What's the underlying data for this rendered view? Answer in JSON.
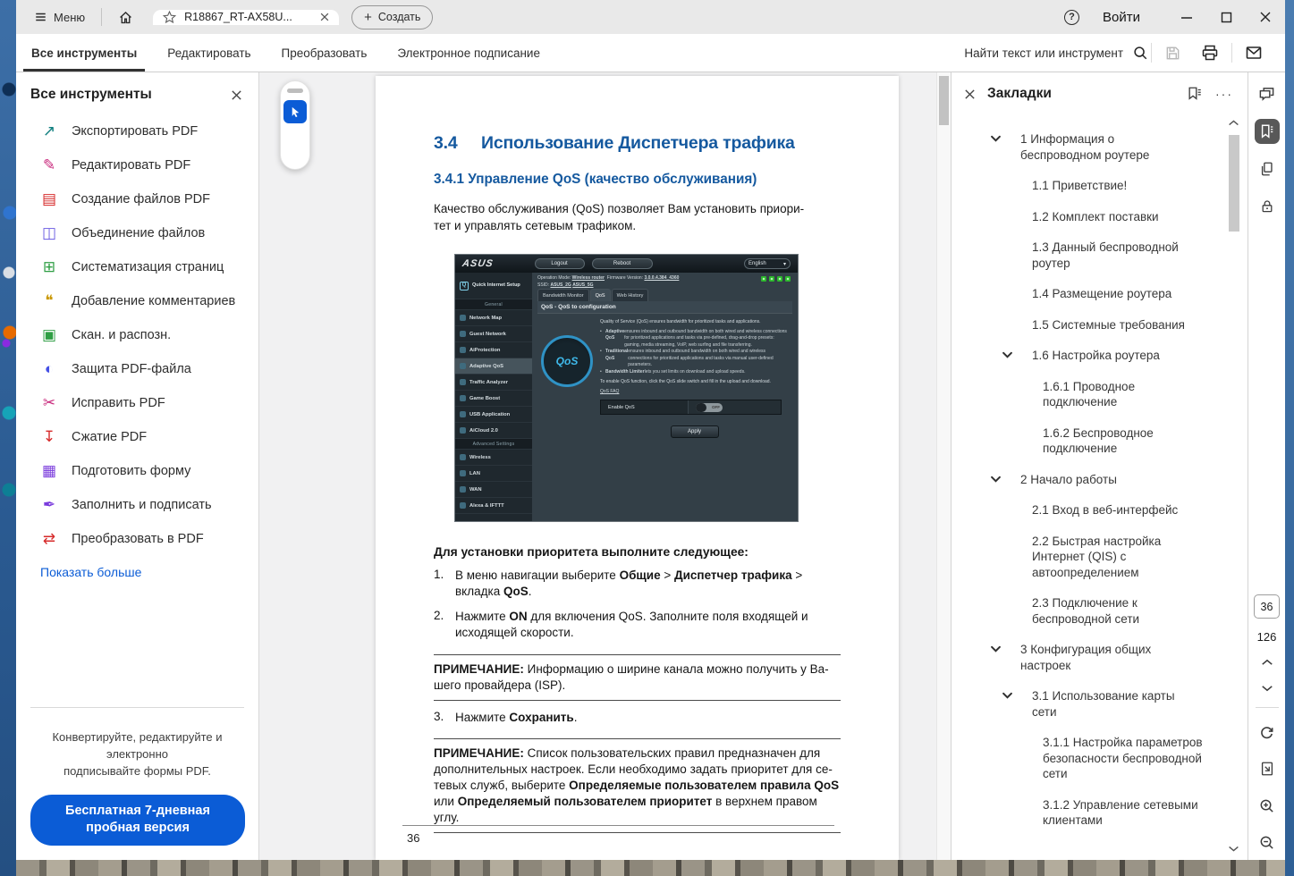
{
  "titlebar": {
    "menu_label": "Меню",
    "tab_title": "R18867_RT-AX58U...",
    "create_label": "Создать",
    "signin_label": "Войти"
  },
  "toolbar": {
    "tabs": [
      {
        "label": "Все инструменты",
        "cls": "active"
      },
      {
        "label": "Редактировать"
      },
      {
        "label": "Преобразовать"
      },
      {
        "label": "Электронное подписание"
      }
    ],
    "find_label": "Найти текст или инструмент"
  },
  "tools_panel": {
    "title": "Все инструменты",
    "items": [
      {
        "label": "Экспортировать PDF",
        "glyph": "↗",
        "color": "#0e7e7e"
      },
      {
        "label": "Редактировать PDF",
        "glyph": "✎",
        "color": "#c92a7d"
      },
      {
        "label": "Создание файлов PDF",
        "glyph": "▤",
        "color": "#d62a2a"
      },
      {
        "label": "Объединение файлов",
        "glyph": "◫",
        "color": "#6a5be2"
      },
      {
        "label": "Систематизация страниц",
        "glyph": "⊞",
        "color": "#2f9e44"
      },
      {
        "label": "Добавление комментариев",
        "glyph": "❝",
        "color": "#c99700"
      },
      {
        "label": "Скан. и распозн.",
        "glyph": "▣",
        "color": "#2f9e44"
      },
      {
        "label": "Защита PDF-файла",
        "glyph": "◐",
        "color": "#4550e5"
      },
      {
        "label": "Исправить PDF",
        "glyph": "✂",
        "color": "#c92a7d"
      },
      {
        "label": "Сжатие PDF",
        "glyph": "↧",
        "color": "#d62a2a"
      },
      {
        "label": "Подготовить форму",
        "glyph": "▦",
        "color": "#7a3bdc"
      },
      {
        "label": "Заполнить и подписать",
        "glyph": "✒",
        "color": "#7a3bdc"
      },
      {
        "label": "Преобразовать в PDF",
        "glyph": "⇄",
        "color": "#d62a2a"
      }
    ],
    "show_more": "Показать больше",
    "promo": "Конвертируйте, редактируйте и электронно\nподписывайте формы PDF.",
    "trial_button": "Бесплатная 7-дневная\nпробная версия"
  },
  "document": {
    "h1_num": "3.4",
    "h1_text": "Использование Диспетчера трафика",
    "h2": "3.4.1 Управление QoS (качество обслуживания)",
    "intro": "Качество обслуживания (QoS) позволяет Вам установить приори-\nтет и управлять сетевым трафиком.",
    "steps_title": "Для установки приоритета выполните следующее:",
    "step1_num": "1.",
    "step1": [
      {
        "t": "В меню навигации выберите "
      },
      {
        "t": "Общие",
        "b": 1
      },
      {
        "t": " > "
      },
      {
        "t": "Диспетчер трафика",
        "b": 1
      },
      {
        "t": " >\nвкладка "
      },
      {
        "t": "QoS",
        "b": 1
      },
      {
        "t": "."
      }
    ],
    "step2_num": "2.",
    "step2": [
      {
        "t": "Нажмите "
      },
      {
        "t": "ON",
        "b": 1
      },
      {
        "t": " для включения QoS. Заполните поля входящей и\nисходящей скорости."
      }
    ],
    "note1": [
      {
        "t": "ПРИМЕЧАНИЕ:",
        "b": 1
      },
      {
        "t": "  Информацию о ширине канала можно получить у Ва-\nшего провайдера (ISP)."
      }
    ],
    "step3_num": "3.",
    "step3": [
      {
        "t": "Нажмите "
      },
      {
        "t": "Сохранить",
        "b": 1
      },
      {
        "t": "."
      }
    ],
    "note2": [
      {
        "t": "ПРИМЕЧАНИЕ:",
        "b": 1
      },
      {
        "t": " Список пользовательских правил предназначен для\nдополнительных настроек. Если необходимо задать приоритет для се-\nтевых служб, выберите "
      },
      {
        "t": "Определяемые пользователем правила QoS",
        "b": 1
      },
      {
        "t": "\nили "
      },
      {
        "t": "Определяемый пользователем приоритет",
        "b": 1
      },
      {
        "t": " в верхнем правом углу."
      }
    ],
    "page_num": "36"
  },
  "router": {
    "logo": "ASUS",
    "logout": "Logout",
    "reboot": "Reboot",
    "language": "English",
    "op_label": "Operation Mode:",
    "op_value": "Wireless router",
    "fw_label": "Firmware Version:",
    "fw_value": "3.0.0.4.384_4360",
    "ssid_label": "SSID:",
    "ssid_2g": "ASUS_2G",
    "ssid_5g": "ASUS_5G",
    "quick": "Quick Internet Setup",
    "sidebar": [
      {
        "label": "General",
        "cls": "hdr"
      },
      {
        "label": "Network Map"
      },
      {
        "label": "Guest Network"
      },
      {
        "label": "AiProtection"
      },
      {
        "label": "Adaptive QoS",
        "cls": "act"
      },
      {
        "label": "Traffic Analyzer"
      },
      {
        "label": "Game Boost"
      },
      {
        "label": "USB Application"
      },
      {
        "label": "AiCloud 2.0"
      },
      {
        "label": "Advanced Settings",
        "cls": "hdr"
      },
      {
        "label": "Wireless"
      },
      {
        "label": "LAN"
      },
      {
        "label": "WAN"
      },
      {
        "label": "Alexa & IFTTT"
      }
    ],
    "tabs": [
      {
        "label": "Bandwidth Monitor"
      },
      {
        "label": "QoS",
        "cls": "act"
      },
      {
        "label": "Web History"
      }
    ],
    "heading": "QoS - QoS to configuration",
    "gauge_label": "QoS",
    "intro": "Quality of Service (QoS) ensures bandwidth for prioritized tasks and applications.",
    "bullet1": [
      {
        "t": "Adaptive QoS",
        "b": 1
      },
      {
        "t": " ensures inbound and outbound bandwidth on both wired and wireless connections for prioritized applications and tasks via pre-defined, drag-and-drop presets: gaming, media streaming, VoIP, web surfing and file transferring."
      }
    ],
    "bullet2": [
      {
        "t": "Traditional QoS",
        "b": 1
      },
      {
        "t": " ensures inbound and outbound bandwidth on both wired and wireless connections for prioritized applications and tasks via manual user-defined parameters."
      }
    ],
    "bullet3": [
      {
        "t": "Bandwidth Limiter",
        "b": 1
      },
      {
        "t": " lets you set limits on download and upload speeds."
      }
    ],
    "enable_note": "To enable QoS function, click the QoS slide switch and fill in the upload and download.",
    "faq": "QoS FAQ",
    "enable_label": "Enable QoS",
    "toggle_state": "OFF",
    "apply": "Apply"
  },
  "bookmarks": {
    "title": "Закладки",
    "items": [
      {
        "label": "1 Информация о беспроводном роутере",
        "lvl": "l0",
        "chev": true
      },
      {
        "label": "1.1 Приветствие!",
        "lvl": "l1"
      },
      {
        "label": "1.2 Комплект поставки",
        "lvl": "l1"
      },
      {
        "label": "1.3 Данный беспроводной роутер",
        "lvl": "l1"
      },
      {
        "label": "1.4 Размещение роутера",
        "lvl": "l1"
      },
      {
        "label": "1.5 Системные требования",
        "lvl": "l1"
      },
      {
        "label": "1.6 Настройка роутера",
        "lvl": "l1",
        "chev": true
      },
      {
        "label": "1.6.1 Проводное подключение",
        "lvl": "l2"
      },
      {
        "label": "1.6.2 Беспроводное подключение",
        "lvl": "l2"
      },
      {
        "label": "2 Начало работы",
        "lvl": "l0",
        "chev": true
      },
      {
        "label": "2.1 Вход в веб-интерфейс",
        "lvl": "l1"
      },
      {
        "label": "2.2 Быстрая настройка Интернет (QIS) с автоопределением",
        "lvl": "l1"
      },
      {
        "label": "2.3 Подключение к беспроводной сети",
        "lvl": "l1"
      },
      {
        "label": "3 Конфигурация общих настроек",
        "lvl": "l0",
        "chev": true
      },
      {
        "label": "3.1 Использование карты сети",
        "lvl": "l1",
        "chev": true
      },
      {
        "label": "3.1.1 Настройка параметров безопасности беспроводной сети",
        "lvl": "l2"
      },
      {
        "label": "3.1.2 Управление сетевыми клиентами",
        "lvl": "l2"
      }
    ]
  },
  "rail": {
    "page_current": "36",
    "page_total": "126"
  }
}
